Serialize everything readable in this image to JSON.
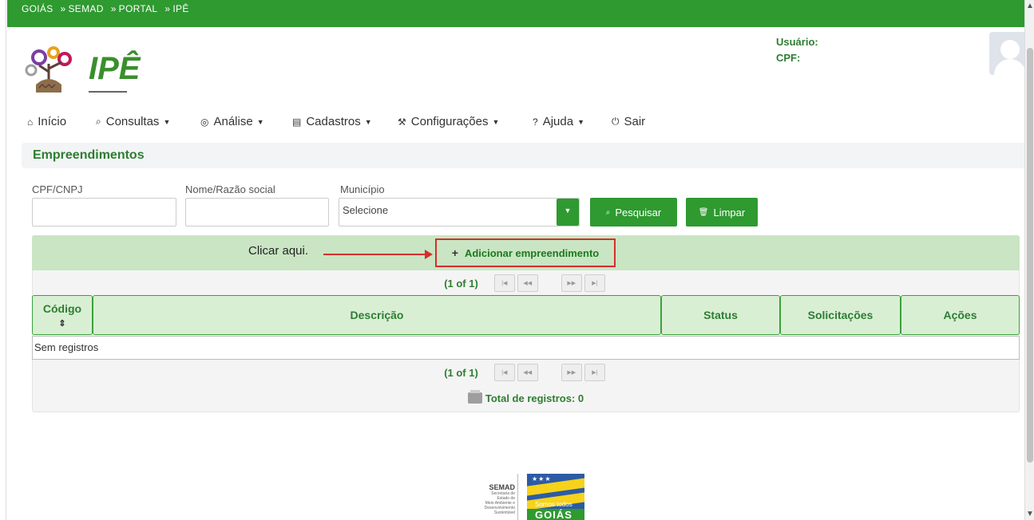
{
  "breadcrumb": [
    "GOIÁS",
    "SEMAD",
    "PORTAL",
    "IPÊ"
  ],
  "breadcrumb_sep": "»",
  "logo": {
    "word": "IPÊ"
  },
  "user": {
    "usuario_label": "Usuário:",
    "cpf_label": "CPF:"
  },
  "nav": [
    {
      "label": "Início",
      "icon": "home-icon",
      "glyph": "⌂",
      "caret": false
    },
    {
      "label": "Consultas",
      "icon": "search-icon",
      "glyph": "⌕",
      "caret": true
    },
    {
      "label": "Análise",
      "icon": "chart-icon",
      "glyph": "◎",
      "caret": true
    },
    {
      "label": "Cadastros",
      "icon": "database-icon",
      "glyph": "▤",
      "caret": true
    },
    {
      "label": "Configurações",
      "icon": "wrench-icon",
      "glyph": "⚒",
      "caret": true
    },
    {
      "label": "Ajuda",
      "icon": "question-icon",
      "glyph": "?",
      "caret": true
    },
    {
      "label": "Sair",
      "icon": "power-icon",
      "glyph": "⏻",
      "caret": false
    }
  ],
  "page_title": "Empreendimentos",
  "filters": {
    "cpf_label": "CPF/CNPJ",
    "cpf_value": "",
    "nome_label": "Nome/Razão social",
    "nome_value": "",
    "municipio_label": "Município",
    "municipio_value": "Selecione",
    "pesquisar": "Pesquisar",
    "limpar": "Limpar"
  },
  "annotation": "Clicar aqui.",
  "add_button": "Adicionar empreendimento",
  "pager_text": "(1 of 1)",
  "table": {
    "headers": [
      "Código",
      "Descrição",
      "Status",
      "Solicitações",
      "Ações"
    ],
    "sort_glyph": "⇕",
    "empty": "Sem registros"
  },
  "total": "Total de registros: 0",
  "footer": {
    "semad": "SEMAD",
    "semad_sub": [
      "Secretaria de",
      "Estado de",
      "Meio Ambiente e",
      "Desenvolvimento",
      "Sustentável"
    ],
    "goias1": "Somos todos",
    "goias2": "GOIÁS"
  },
  "colors": {
    "brand_green": "#2e9a30",
    "accent_red": "#d32f2f"
  }
}
